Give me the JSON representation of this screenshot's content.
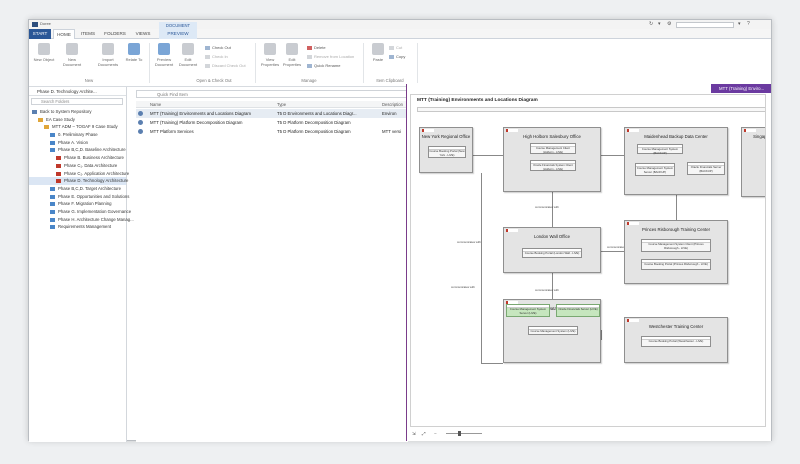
{
  "app": {
    "title": "Doree"
  },
  "tabs": [
    {
      "label": "START"
    },
    {
      "label": "HOME"
    },
    {
      "label": "ITEMS"
    },
    {
      "label": "FOLDERS"
    },
    {
      "label": "VIEWS"
    },
    {
      "label": "PREVIEW",
      "context": "DOCUMENT"
    }
  ],
  "ribbon": {
    "new": {
      "new_object": "New Object",
      "new_document": "New Document",
      "import_documents": "Import Documents",
      "relate_to": "Relate To",
      "group": "New"
    },
    "open": {
      "preview_document": "Preview Document",
      "edit_document": "Edit Document",
      "check_out": "Check Out",
      "check_in": "Check In",
      "discard_check_out": "Discard Check Out",
      "group": "Open & Check Out"
    },
    "manage": {
      "view_properties": "View Properties",
      "edit_properties": "Edit Properties",
      "delete": "Delete",
      "remove_from_location": "Remove from Location",
      "quick_rename": "Quick Rename",
      "group": "Manage"
    },
    "clipboard": {
      "paste": "Paste",
      "cut": "Cut",
      "copy": "Copy",
      "group": "Item Clipboard"
    }
  },
  "left_pane": {
    "breadcrumb": "Phase D. Technology Archite...",
    "search_placeholder": "Search Folders",
    "tree": [
      {
        "label": "Back to System Repository",
        "indent": 0,
        "icon": "back"
      },
      {
        "label": "EA Case Study",
        "indent": 1,
        "icon": "folder"
      },
      {
        "label": "MTT ADM – TOGAF 9 Case Study",
        "indent": 2,
        "icon": "folder"
      },
      {
        "label": "0. Preliminary Phase",
        "indent": 3,
        "icon": "phase"
      },
      {
        "label": "Phase A. Vision",
        "indent": 3,
        "icon": "phase"
      },
      {
        "label": "Phase B,C,D. Baseline Architecture",
        "indent": 3,
        "icon": "phase"
      },
      {
        "label": "Phase B. Business Architecture",
        "indent": 4,
        "icon": "red"
      },
      {
        "label": "Phase C₁. Data Architecture",
        "indent": 4,
        "icon": "red"
      },
      {
        "label": "Phase C₂. Application Architecture",
        "indent": 4,
        "icon": "red"
      },
      {
        "label": "Phase D. Technology Architecture",
        "indent": 4,
        "icon": "red",
        "selected": true
      },
      {
        "label": "Phase B,C,D. Target Architecture",
        "indent": 3,
        "icon": "phase"
      },
      {
        "label": "Phase E. Opportunities and Solutions",
        "indent": 3,
        "icon": "phase"
      },
      {
        "label": "Phase F. Migration Planning",
        "indent": 3,
        "icon": "phase"
      },
      {
        "label": "Phase G. Implementation Governance",
        "indent": 3,
        "icon": "phase"
      },
      {
        "label": "Phase H. Architecture Change Manag...",
        "indent": 3,
        "icon": "phase"
      },
      {
        "label": "Requirements Management",
        "indent": 3,
        "icon": "phase"
      }
    ]
  },
  "center_pane": {
    "quick_find_placeholder": "Quick Find Item",
    "columns": {
      "name": "Name",
      "type": "Type",
      "description": "Description"
    },
    "rows": [
      {
        "name": "MTT (Training) Environments and Locations Diagram",
        "type": "T5 D Environments and Locations Diagr...",
        "description": "Environ"
      },
      {
        "name": "MTT (Training) Platform Decomposition Diagram",
        "type": "T5 D Platform Decomposition Diagram",
        "description": ""
      },
      {
        "name": "MTT Platform Services",
        "type": "T5 D Platform Decomposition Diagram",
        "description": "MTT versi"
      }
    ]
  },
  "preview": {
    "tab_label": "MTT (Training) Enviro...",
    "diagram_title": "MTT (Training) Environments and Locations Diagram",
    "locations": [
      {
        "name": "New York Regional Office",
        "items": [
          "Course Booking Portal (New York - LIVE)"
        ]
      },
      {
        "name": "High Holborn Salesbury Office",
        "items": [
          "Course Management Client (Holborn - LIVE)",
          "Oracle Financials System Client (Holborn - LIVE)"
        ]
      },
      {
        "name": "Maidenhead Backup Data Center",
        "items": [
          "Course Management System (BACKUP)",
          "Course Management System Server (BACKUP)",
          "Oracle Financials Server (BACKUP)"
        ]
      },
      {
        "name": "Singapo",
        "items": []
      },
      {
        "name": "London Wall Office",
        "items": [
          "Course Booking Portal (London Wall - LIVE)"
        ]
      },
      {
        "name": "Princes Risborough Training Center",
        "items": [
          "Course Management System Client (Princes Risborough - LIVE)",
          "Course Booking Portal (Princes Risborough - LIVE)"
        ]
      },
      {
        "name": "Slough Data Center",
        "items": [
          "Course Management System Server (LIVE)",
          "Oracle Financials Server (LIVE)",
          "Course Management System (LIVE)"
        ]
      },
      {
        "name": "Westchester Training Center",
        "items": [
          "Course Booking Portal (Westchester - LIVE)"
        ]
      }
    ],
    "connector_label": "communicates with"
  }
}
